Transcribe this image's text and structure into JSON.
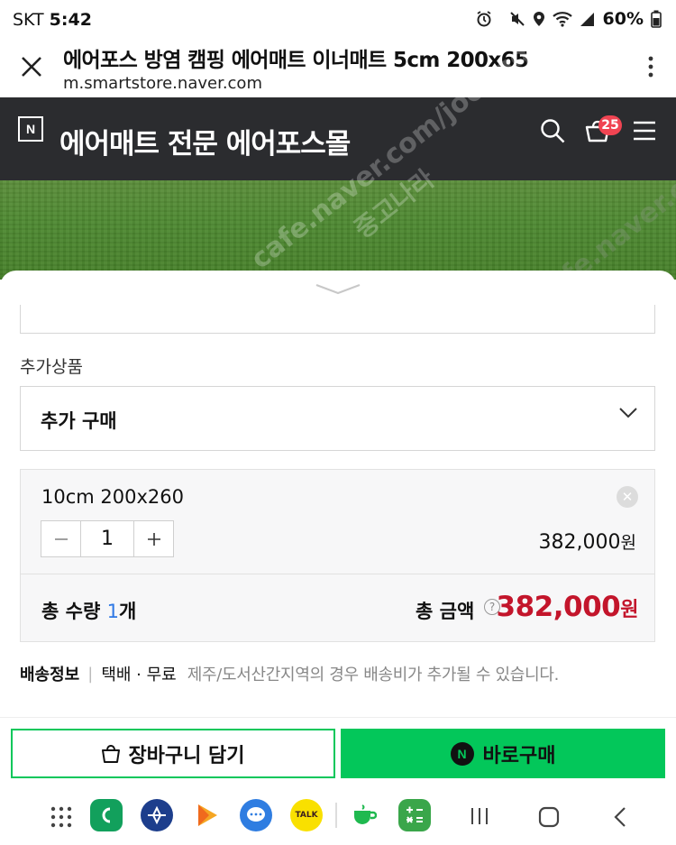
{
  "status_bar": {
    "carrier": "SKT",
    "time": "5:42",
    "battery": "60%"
  },
  "browser": {
    "title": "에어포스 방염 캠핑 에어매트 이너매트 5cm 200x65",
    "url": "m.smartstore.naver.com"
  },
  "store": {
    "logo_letter": "N",
    "name": "에어매트 전문 에어포스몰",
    "cart_count": "25"
  },
  "addon": {
    "label": "추가상품",
    "select_value": "추가 구매"
  },
  "selected_option": {
    "name": "10cm 200x260",
    "quantity": "1",
    "price": "382,000",
    "price_unit": "원"
  },
  "totals": {
    "qty_label": "총 수량",
    "qty_value": "1",
    "qty_unit": "개",
    "amount_label": "총 금액",
    "amount_value": "382,000",
    "amount_unit": "원"
  },
  "shipping": {
    "label": "배송정보",
    "method": "택배 · 무료",
    "note": "제주/도서산간지역의 경우 배송비가 추가될 수 있습니다."
  },
  "actions": {
    "cart_label": "장바구니 담기",
    "buy_label": "바로구매",
    "npay_letter": "N"
  },
  "watermarks": [
    "cafe.naver.com/joonggo",
    "중고나라"
  ],
  "colors": {
    "header_bg": "#2b2c2f",
    "naver_green": "#03c75a",
    "price_red": "#c3152b",
    "badge_red": "#f04452",
    "qty_blue": "#2e78e5"
  },
  "nav_apps": [
    "apps-grid-icon",
    "phone-icon",
    "military-app-icon",
    "play-store-icon",
    "messages-icon",
    "kakaotalk-icon",
    "naver-cafe-icon",
    "calculator-icon"
  ],
  "talk_label": "TALK"
}
